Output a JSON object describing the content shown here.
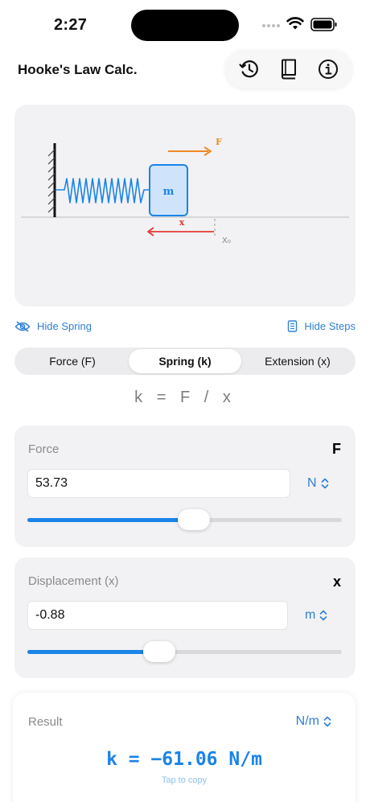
{
  "status_bar": {
    "time": "2:27"
  },
  "app": {
    "title": "Hooke's Law Calc."
  },
  "toolbar": {
    "history_icon": "history-clock-icon",
    "book_icon": "book-icon",
    "info_icon": "info-circle-icon"
  },
  "diagram": {
    "force_label": "F",
    "mass_label": "m",
    "displacement_label": "x",
    "origin_label": "X₀",
    "colors": {
      "spring": "#1a84e8",
      "force": "#f08a24",
      "displacement": "#e53935"
    }
  },
  "links": {
    "hide_spring": "Hide Spring",
    "hide_steps": "Hide Steps"
  },
  "tabs": [
    {
      "label": "Force (F)",
      "active": false
    },
    {
      "label": "Spring (k)",
      "active": true
    },
    {
      "label": "Extension (x)",
      "active": false
    }
  ],
  "formula": "k = F / x",
  "force": {
    "label": "Force",
    "symbol": "F",
    "value": "53.73",
    "unit": "N",
    "slider_fraction": 0.53
  },
  "displacement": {
    "label": "Displacement (x)",
    "symbol": "x",
    "value": "-0.88",
    "unit": "m",
    "slider_fraction": 0.42
  },
  "result": {
    "label": "Result",
    "unit": "N/m",
    "value": "k = −61.06 N/m",
    "hint": "Tap to copy"
  },
  "accent_color": "#1a84e8"
}
